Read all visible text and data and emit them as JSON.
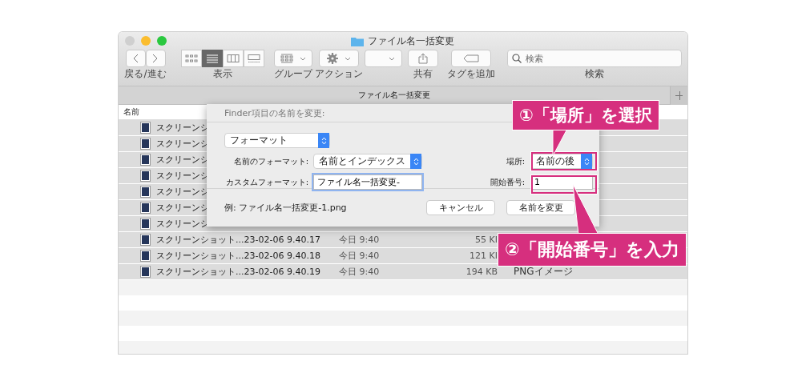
{
  "window": {
    "title": "ファイル名一括変更"
  },
  "toolbar": {
    "nav_label": "戻る/進む",
    "view_segments": [
      {
        "kind": "icons",
        "selected": false
      },
      {
        "kind": "list",
        "selected": true
      },
      {
        "kind": "columns",
        "selected": false
      },
      {
        "kind": "gallery",
        "selected": false
      }
    ],
    "view_label": "表示",
    "group_label": "グループ",
    "action_label": "アクション",
    "share_label": "共有",
    "tag_label": "タグを追加",
    "search": {
      "placeholder": "検索",
      "label": "検索"
    }
  },
  "tab": {
    "label": "ファイル名一括変更"
  },
  "list": {
    "column_header": "名前",
    "rows": [
      {
        "name": "スクリーンシ",
        "selected": true
      },
      {
        "name": "スクリーンシ",
        "selected": true
      },
      {
        "name": "スクリーンシ",
        "selected": true
      },
      {
        "name": "スクリーンシ",
        "selected": true
      },
      {
        "name": "スクリーンシ",
        "selected": true
      },
      {
        "name": "スクリーンシ",
        "selected": true
      },
      {
        "name": "スクリーンシ",
        "selected": true
      },
      {
        "name": "スクリーンショット...23-02-06 9.40.17",
        "date": "今日 9:40",
        "size": "55 KI",
        "selected": true
      },
      {
        "name": "スクリーンショット...23-02-06 9.40.18",
        "date": "今日 9:40",
        "size": "121 KI",
        "selected": true
      },
      {
        "name": "スクリーンショット...23-02-06 9.40.19",
        "date": "今日 9:40",
        "size": "194 KB",
        "kind": "PNGイメージ",
        "selected": true
      }
    ]
  },
  "dialog": {
    "title": "Finder項目の名前を変更:",
    "mode": "フォーマット",
    "name_format_label": "名前のフォーマット:",
    "name_format": "名前とインデックス",
    "place_label": "場所:",
    "place": "名前の後",
    "custom_label": "カスタムフォーマット:",
    "custom_value": "ファイル名一括変更-",
    "start_label": "開始番号:",
    "start_value": "1",
    "example": "例: ファイル名一括変更-1.png",
    "buttons": [
      "キャンセル",
      "名前を変更"
    ]
  },
  "callouts": [
    "①「場所」を選択",
    "②「開始番号」を入力"
  ]
}
